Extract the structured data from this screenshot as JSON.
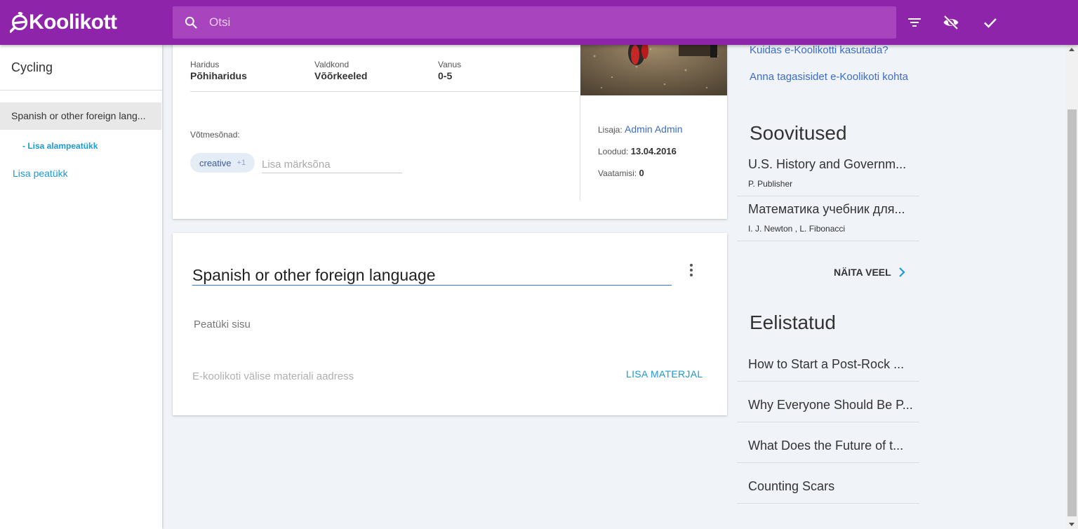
{
  "header": {
    "logo_text": "Koolikott",
    "search_placeholder": "Otsi",
    "icons": [
      "filter-icon",
      "hidden-eye-icon",
      "check-icon"
    ],
    "bg_color": "#8e24aa"
  },
  "sidebar": {
    "title": "Cycling",
    "active_item": "Spanish or other foreign lang...",
    "sub_add": "- Lisa alampeatükk",
    "add_chapter": "Lisa peatükk"
  },
  "material": {
    "haridus_label": "Haridus",
    "haridus_value": "Põhiharidus",
    "valdkond_label": "Valdkond",
    "valdkond_value": "Võõrkeeled",
    "vanus_label": "Vanus",
    "vanus_value": "0-5",
    "keywords_label": "Võtmesõnad:",
    "chip_label": "creative",
    "chip_more": "+1",
    "keyword_placeholder": "Lisa märksõna",
    "added_by_label": "Lisaja:",
    "added_by": "Admin Admin",
    "created_label": "Loodud:",
    "created": "13.04.2016",
    "views_label": "Vaatamisi:",
    "views": "0"
  },
  "chapter": {
    "title": "Spanish or other foreign language",
    "content_placeholder": "Peatüki sisu",
    "url_placeholder": "E-koolikoti välise materiali aadress",
    "add_material": "LISA MATERJAL"
  },
  "right": {
    "link1": "Kuidas e-Koolikotti kasutada?",
    "link2": "Anna tagasisidet e-Koolikoti kohta",
    "recommendations_title": "Soovitused",
    "recommendations": [
      {
        "title": "U.S. History and Governm...",
        "author": "P. Publisher"
      },
      {
        "title": "Математика учебник для...",
        "author": "I. J. Newton , L. Fibonacci"
      }
    ],
    "show_more": "NÄITA VEEL",
    "preferred_title": "Eelistatud",
    "preferred": [
      {
        "title": "How to Start a Post-Rock ..."
      },
      {
        "title": "Why Everyone Should Be P..."
      },
      {
        "title": "What Does the Future of t..."
      },
      {
        "title": "Counting Scars"
      }
    ]
  }
}
